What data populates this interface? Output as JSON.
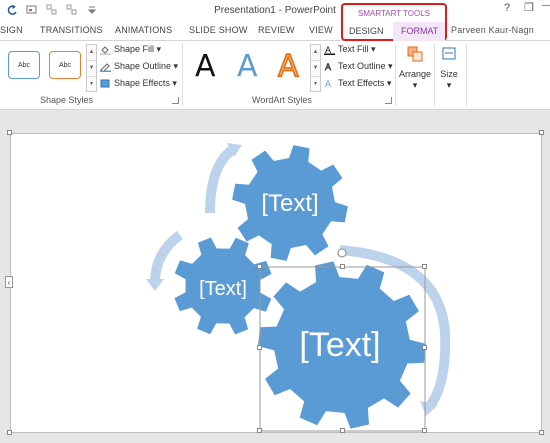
{
  "titlebar": {
    "title": "Presentation1 - PowerPoint",
    "help": "?",
    "minimize": "—",
    "restore": "❐"
  },
  "tabs": [
    {
      "label": "SIGN"
    },
    {
      "label": "TRANSITIONS"
    },
    {
      "label": "ANIMATIONS"
    },
    {
      "label": "SLIDE SHOW"
    },
    {
      "label": "REVIEW"
    },
    {
      "label": "VIEW"
    }
  ],
  "contextual": {
    "group_label": "SMARTART TOOLS",
    "design_tab": "DESIGN",
    "format_tab": "FORMAT"
  },
  "user": "Parveen Kaur-Nagn",
  "ribbon": {
    "shape_styles": {
      "swatch1": "Abc",
      "swatch2": "Abc",
      "shape_fill": "Shape Fill",
      "shape_outline": "Shape Outline",
      "shape_effects": "Shape Effects",
      "group_label": "Shape Styles"
    },
    "wordart_styles": {
      "letter": "A",
      "text_fill": "Text Fill",
      "text_outline": "Text Outline",
      "text_effects": "Text Effects",
      "group_label": "WordArt Styles"
    },
    "arrange_label": "Arrange",
    "size_label": "Size"
  },
  "smartart": {
    "gear1": "[Text]",
    "gear2": "[Text]",
    "gear3": "[Text]"
  },
  "colors": {
    "gear": "#5b9bd5",
    "arrow": "#bdd3ec",
    "highlight": "#e41a1a",
    "format_tab": "#8b3aa3"
  }
}
